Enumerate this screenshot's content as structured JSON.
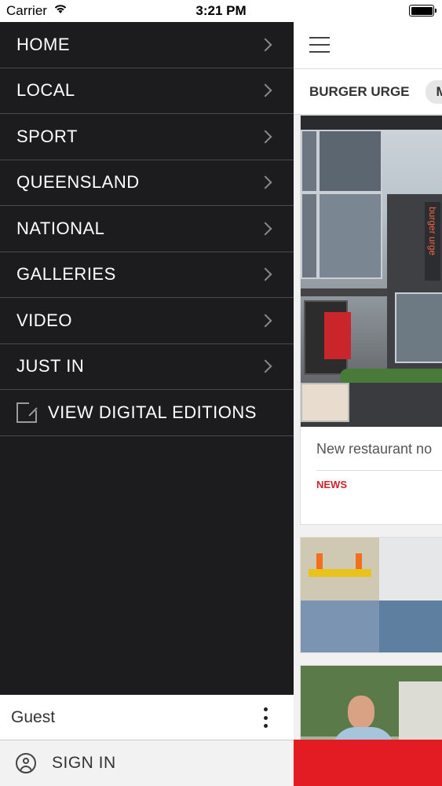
{
  "status_bar": {
    "carrier": "Carrier",
    "time": "3:21 PM"
  },
  "drawer": {
    "menu_items": [
      {
        "label": "HOME"
      },
      {
        "label": "LOCAL"
      },
      {
        "label": "SPORT"
      },
      {
        "label": "QUEENSLAND"
      },
      {
        "label": "NATIONAL"
      },
      {
        "label": "GALLERIES"
      },
      {
        "label": "VIDEO"
      },
      {
        "label": "JUST IN"
      }
    ],
    "digital_editions": {
      "label": "VIEW DIGITAL EDITIONS",
      "icon": "external-link-icon"
    },
    "guest": {
      "label": "Guest",
      "icon": "kebab-menu-icon"
    },
    "sign_in": {
      "label": "SIGN IN",
      "icon": "user-icon"
    }
  },
  "content": {
    "tabs": [
      {
        "label": "BURGER URGE"
      },
      {
        "label": "MA"
      }
    ],
    "cards": [
      {
        "title": "New restaurant no",
        "tag": "NEWS",
        "image": "restaurant-building-photo"
      },
      {
        "image": "construction-workers-photo"
      },
      {
        "image": "man-portrait-photo"
      }
    ]
  },
  "colors": {
    "drawer_bg": "#1c1b1d",
    "accent_red": "#e31b23",
    "tag_red": "#d0232a"
  }
}
